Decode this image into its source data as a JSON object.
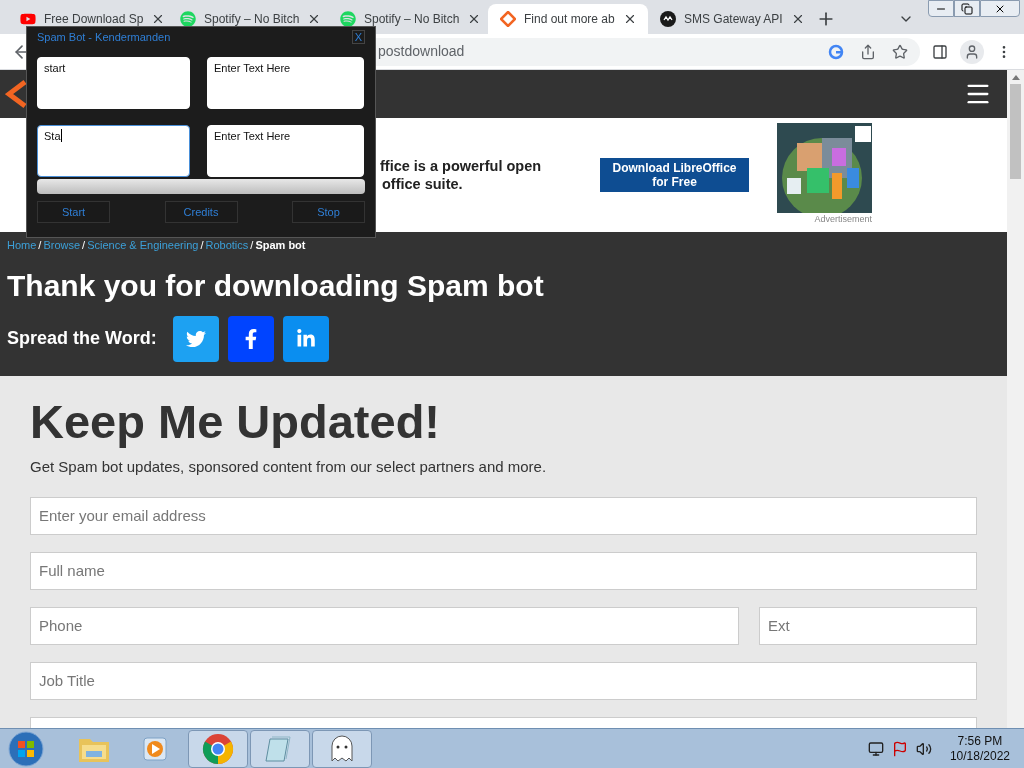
{
  "browser": {
    "tabs": [
      {
        "kind": "youtube",
        "title": "Free Download Sp",
        "selected": false
      },
      {
        "kind": "spotify",
        "title": "Spotify – No Bitch",
        "selected": false
      },
      {
        "kind": "spotify",
        "title": "Spotify – No Bitch",
        "selected": false
      },
      {
        "kind": "site",
        "title": "Find out more ab",
        "selected": true
      },
      {
        "kind": "cm",
        "title": "SMS Gateway API",
        "selected": false
      }
    ],
    "url": "postdownload"
  },
  "spam_bot": {
    "title": "Spam Bot - Kendermanden",
    "close": "X",
    "fields": [
      {
        "value": "start",
        "focused": false
      },
      {
        "value": "Enter Text Here",
        "focused": false
      },
      {
        "value": "Sta",
        "focused": true
      },
      {
        "value": "Enter Text Here",
        "focused": false
      }
    ],
    "progress": {
      "level": 0
    },
    "buttons": [
      "Start",
      "Credits",
      "Stop"
    ]
  },
  "ad": {
    "lines": [
      "ffice is a powerful open",
      "office suite."
    ],
    "button": "Download LibreOffice for Free",
    "caption": "Advertisement"
  },
  "hero": {
    "separator": "/",
    "breadcrumb": [
      {
        "label": "Home",
        "current": false
      },
      {
        "label": "Browse",
        "current": false
      },
      {
        "label": "Science & Engineering",
        "current": false
      },
      {
        "label": "Robotics",
        "current": false
      },
      {
        "label": "Spam bot",
        "current": true
      }
    ],
    "title": "Thank you for downloading Spam bot",
    "share_label": "Spread the Word:",
    "share": [
      {
        "kind": "twitter"
      },
      {
        "kind": "facebook"
      },
      {
        "kind": "linkedin"
      }
    ]
  },
  "signup": {
    "title": "Keep Me Updated!",
    "text": "Get Spam bot updates, sponsored content from our select partners and more.",
    "rows": [
      [
        {
          "placeholder": "Enter your email address"
        }
      ],
      [
        {
          "placeholder": "Full name"
        }
      ],
      [
        {
          "placeholder": "Phone"
        },
        {
          "placeholder": "Ext"
        }
      ],
      [
        {
          "placeholder": "Job Title"
        }
      ]
    ]
  },
  "taskbar": {
    "apps": [
      {
        "kind": "folder",
        "active": false
      },
      {
        "kind": "media",
        "active": false
      },
      {
        "kind": "chrome",
        "active": true
      },
      {
        "kind": "notepad",
        "active": true
      },
      {
        "kind": "ghost",
        "active": true
      }
    ],
    "time": "7:56 PM",
    "date": "10/18/2022"
  }
}
